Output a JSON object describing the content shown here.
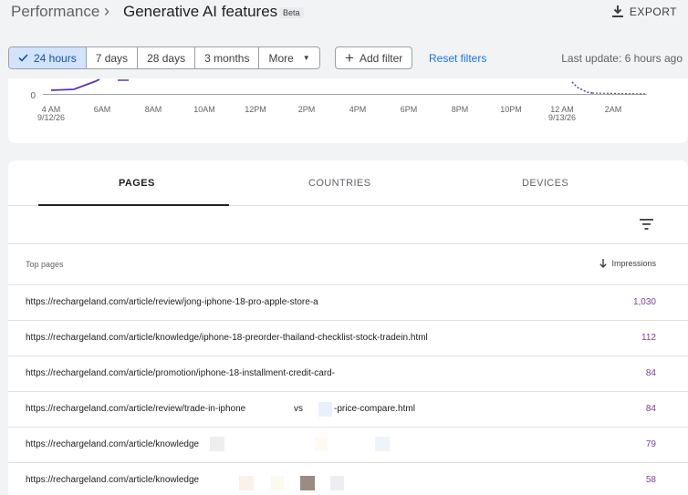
{
  "header": {
    "breadcrumb_root": "Performance",
    "breadcrumb_sep": "›",
    "title": "Generative AI features",
    "badge": "Beta",
    "export_label": "EXPORT"
  },
  "toolbar": {
    "ranges": [
      {
        "label": "24 hours",
        "active": true
      },
      {
        "label": "7 days",
        "active": false
      },
      {
        "label": "28 days",
        "active": false
      },
      {
        "label": "3 months",
        "active": false
      },
      {
        "label": "More",
        "active": false
      }
    ],
    "add_filter_label": "Add filter",
    "reset_label": "Reset filters",
    "last_update": "Last update: 6 hours ago"
  },
  "chart": {
    "y_tick": "0",
    "x_ticks": [
      "4 AM",
      "6AM",
      "8AM",
      "10AM",
      "12PM",
      "2PM",
      "4PM",
      "6PM",
      "8PM",
      "10PM",
      "12 AM",
      "2AM"
    ],
    "date_labels": {
      "start": "9/12/26",
      "end": "9/13/26"
    },
    "line_color": "#5e35b1"
  },
  "tabs": [
    {
      "label": "PAGES",
      "active": true
    },
    {
      "label": "COUNTRIES",
      "active": false
    },
    {
      "label": "DEVICES",
      "active": false
    }
  ],
  "table": {
    "col_dimension": "Top pages",
    "col_metric": "Impressions",
    "rows": [
      {
        "url": "https://rechargeland.com/article/review/jong-iphone-18-pro-apple-store-a",
        "value": "1,030"
      },
      {
        "url": "https://rechargeland.com/article/knowledge/iphone-18-preorder-thailand-checklist-stock-tradein.html",
        "value": "112"
      },
      {
        "url": "https://rechargeland.com/article/promotion/iphone-18-installment-credit-card-",
        "value": "84"
      },
      {
        "url": "https://rechargeland.com/article/review/trade-in-iphone",
        "vs": "vs",
        "suffix": "-price-compare.html",
        "value": "84"
      },
      {
        "url": "https://rechargeland.com/article/knowledge",
        "value": "79"
      },
      {
        "url": "https://rechargeland.com/article/knowledge",
        "value": "58"
      }
    ]
  }
}
